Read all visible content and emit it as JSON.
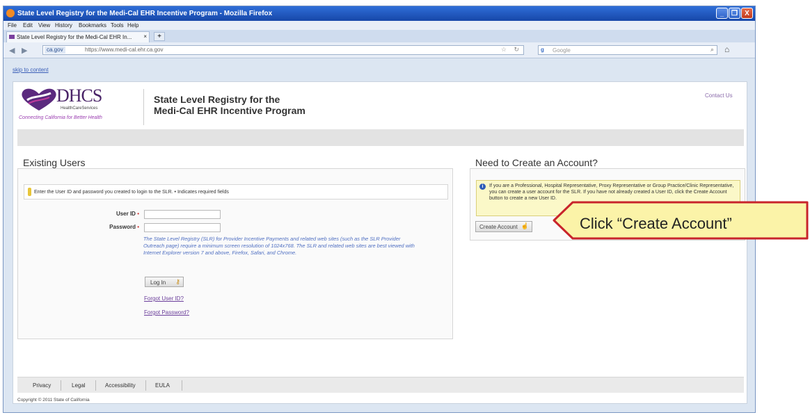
{
  "window": {
    "title": "State Level Registry for the Medi-Cal EHR Incentive Program - Mozilla Firefox",
    "controls": {
      "minimize": "_",
      "maximize": "❐",
      "close": "X"
    }
  },
  "menu": [
    "File",
    "Edit",
    "View",
    "History",
    "Bookmarks",
    "Tools",
    "Help"
  ],
  "tab": {
    "title": "State Level Registry for the Medi-Cal EHR In...",
    "close": "×",
    "new_tab": "+"
  },
  "nav": {
    "back": "◀",
    "forward": "▶",
    "identity": "ca.gov",
    "url": "https://www.medi-cal.ehr.ca.gov",
    "search_placeholder": "Google"
  },
  "skip_link": "skip to content",
  "header": {
    "logo_text": "DHCS",
    "logo_subtext": "HealthCareServices",
    "logo_tagline": "Connecting California for Better Health",
    "site_title_line1": "State Level Registry for the",
    "site_title_line2": "Medi-Cal EHR Incentive Program",
    "contact": "Contact Us"
  },
  "existing": {
    "heading": "Existing Users",
    "note": "Enter the User ID and password you created to login to the SLR.   • Indicates required fields",
    "user_id_label": "User ID",
    "password_label": "Password",
    "required_marker": "•",
    "help_text": "The State Level Registry (SLR) for Provider Incentive Payments and related web sites (such as the SLR Provider Outreach page) require a minimum screen resolution of 1024x768. The SLR and related web sites are best viewed with Internet Explorer version 7 and above, Firefox, Safari, and Chrome.",
    "login_button": "Log In",
    "forgot_user": "Forgot User ID?",
    "forgot_password": "Forgot Password?"
  },
  "create": {
    "heading": "Need to Create an Account?",
    "info": "If you are a Professional, Hospital Representative, Proxy Representative or Group Practice/Clinic Representative, you can create a user account for the SLR. If you have not already created a User ID, click the Create Account button to create a new User ID.",
    "button": "Create Account"
  },
  "footer": {
    "links": [
      "Privacy",
      "Legal",
      "Accessibility",
      "EULA"
    ],
    "copyright": "Copyright © 2011 State of California"
  },
  "callout": {
    "text": "Click “Create Account”"
  },
  "colors": {
    "titlebar": "#1f55c0",
    "logo_purple": "#4a2468",
    "help_blue": "#4f6fc2",
    "callout_border": "#c8242b",
    "callout_fill": "#fbf3a8"
  }
}
